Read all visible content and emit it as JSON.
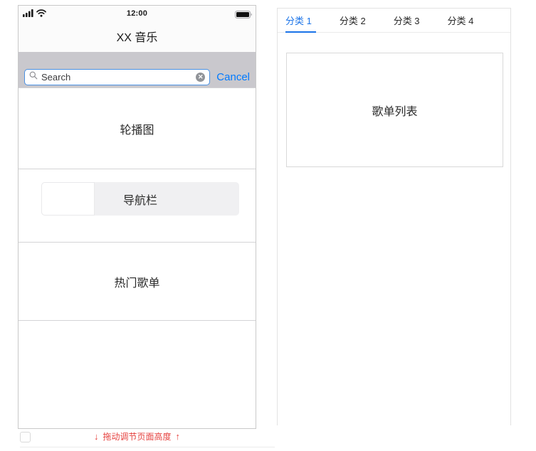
{
  "colors": {
    "accent_blue": "#1a73e8",
    "ios_blue": "#007aff",
    "search_band_gray": "#c9c8cd",
    "alert_red": "#e64340"
  },
  "phone": {
    "status_bar": {
      "time": "12:00",
      "signal_icon": "cellular-signal",
      "wifi_icon": "wifi",
      "battery_icon": "battery-full"
    },
    "title": "XX 音乐",
    "search_bar": {
      "search_icon": "magnifier",
      "placeholder": "Search",
      "clear_icon": "clear-circle-x",
      "clear_glyph": "✕",
      "cancel_label": "Cancel"
    },
    "sections": {
      "carousel_label": "轮播图",
      "nav_label": "导航栏",
      "hot_playlists_label": "热门歌单"
    },
    "drag_hint": {
      "down_arrow": "↓",
      "label": "拖动调节页面高度",
      "up_arrow": "↑"
    }
  },
  "category_panel": {
    "tabs": [
      {
        "label": "分类 1",
        "active": true
      },
      {
        "label": "分类 2",
        "active": false
      },
      {
        "label": "分类 3",
        "active": false
      },
      {
        "label": "分类 4",
        "active": false
      }
    ],
    "playlist_box_label": "歌单列表"
  }
}
